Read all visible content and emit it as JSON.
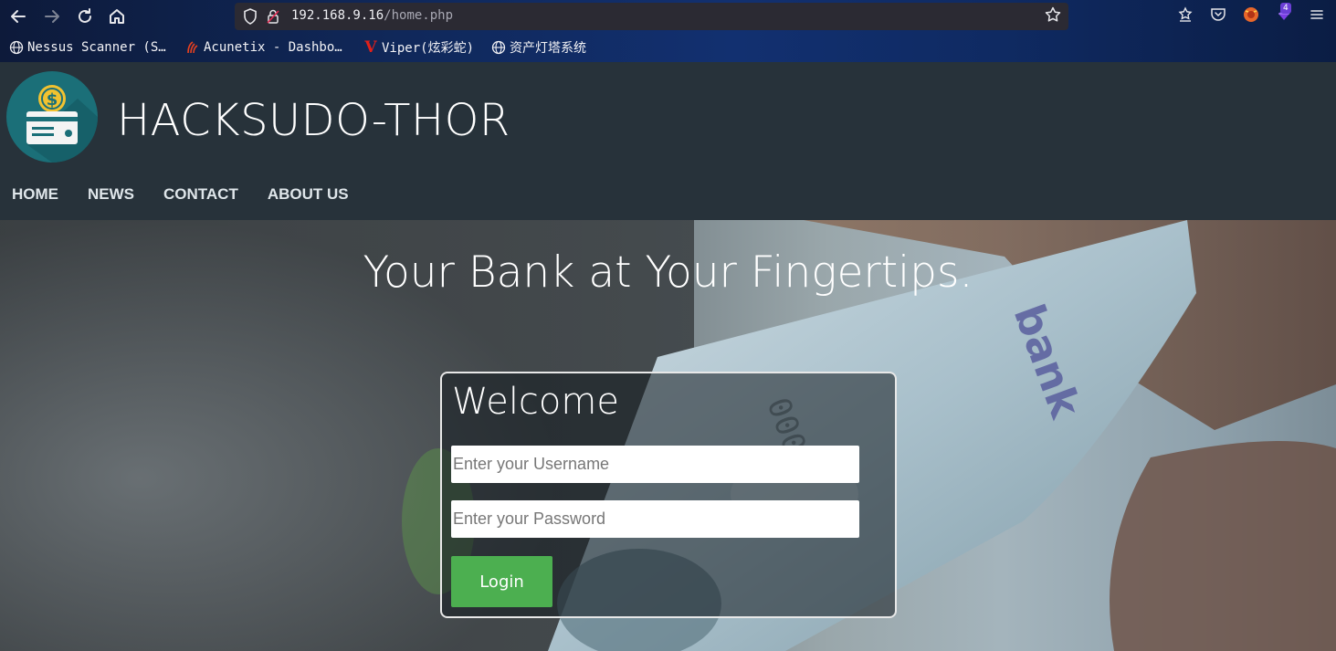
{
  "browser": {
    "url_host": "192.168.9.16",
    "url_path": "/home.php",
    "extension_badge": "4",
    "bookmarks": [
      {
        "label": "Nessus Scanner (S…",
        "icon": "globe-icon"
      },
      {
        "label": "Acunetix - Dashbo…",
        "icon": "acunetix-icon"
      },
      {
        "label": "Viper(炫彩蛇)",
        "icon": "viper-icon"
      },
      {
        "label": "资产灯塔系统",
        "icon": "globe-icon"
      }
    ]
  },
  "site": {
    "title": "HACKSUDO-THOR",
    "menu": [
      "HOME",
      "NEWS",
      "CONTACT",
      "ABOUT US"
    ]
  },
  "hero": {
    "headline": "Your Bank at Your Fingertips."
  },
  "login": {
    "title": "Welcome",
    "username_placeholder": "Enter your Username",
    "password_placeholder": "Enter your Password",
    "button_label": "Login"
  },
  "colors": {
    "header_bg": "#27323a",
    "login_button": "#4caf50",
    "logo_circle": "#1b6f78",
    "coin": "#f2c230"
  }
}
